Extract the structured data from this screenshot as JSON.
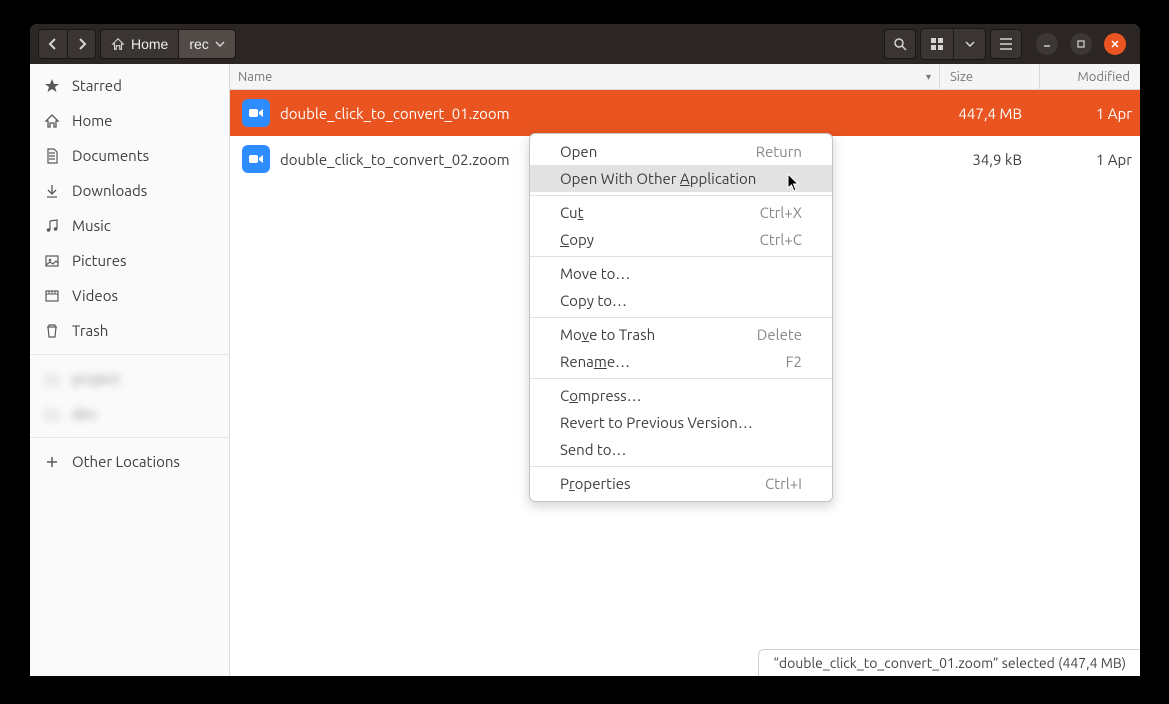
{
  "titlebar": {
    "breadcrumb": {
      "home": "Home",
      "current": "rec"
    }
  },
  "sidebar": {
    "items": [
      {
        "label": "Starred"
      },
      {
        "label": "Home"
      },
      {
        "label": "Documents"
      },
      {
        "label": "Downloads"
      },
      {
        "label": "Music"
      },
      {
        "label": "Pictures"
      },
      {
        "label": "Videos"
      },
      {
        "label": "Trash"
      }
    ],
    "other": "Other Locations"
  },
  "list": {
    "headers": {
      "name": "Name",
      "size": "Size",
      "modified": "Modified"
    },
    "rows": [
      {
        "name": "double_click_to_convert_01.zoom",
        "size": "447,4 MB",
        "modified": "1 Apr"
      },
      {
        "name": "double_click_to_convert_02.zoom",
        "size": "34,9 kB",
        "modified": "1 Apr"
      }
    ]
  },
  "context_menu": {
    "open": {
      "label": "Open",
      "shortcut": "Return"
    },
    "open_with_pre": "Open With Other ",
    "open_with_u": "A",
    "open_with_post": "pplication",
    "cut_pre": "Cu",
    "cut_u": "t",
    "cut_sc": "Ctrl+X",
    "copy_u": "C",
    "copy_post": "opy",
    "copy_sc": "Ctrl+C",
    "move_to": "Move to…",
    "copy_to": "Copy to…",
    "trash_pre": "Mo",
    "trash_u": "v",
    "trash_post": "e to Trash",
    "trash_sc": "Delete",
    "rename_pre": "Rena",
    "rename_u": "m",
    "rename_post": "e…",
    "rename_sc": "F2",
    "compress_pre": "C",
    "compress_u": "o",
    "compress_post": "mpress…",
    "revert": "Revert to Previous Version…",
    "send": "Send to…",
    "props_pre": "P",
    "props_u": "r",
    "props_post": "operties",
    "props_sc": "Ctrl+I"
  },
  "statusbar": {
    "text": "“double_click_to_convert_01.zoom” selected  (447,4 MB)"
  }
}
